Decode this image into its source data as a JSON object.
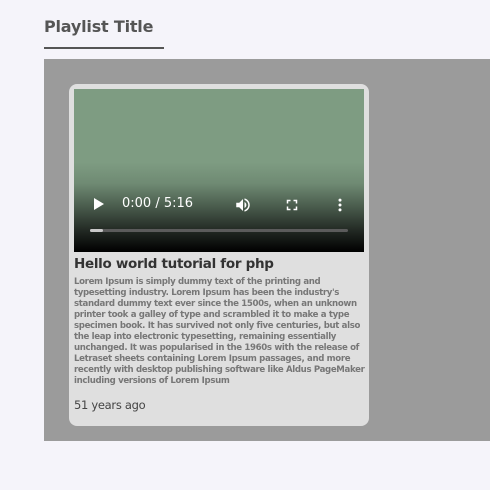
{
  "playlist": {
    "title": "Playlist Title"
  },
  "videos": [
    {
      "title": "Hello world tutorial for php",
      "description": "Lorem Ipsum is simply dummy text of the printing and typesetting industry. Lorem Ipsum has been the industry's standard dummy text ever since the 1500s, when an unknown printer took a galley of type and scrambled it to make a type specimen book. It has survived not only five centuries, but also the leap into electronic typesetting, remaining essentially unchanged. It was popularised in the 1960s with the release of Letraset sheets containing Lorem Ipsum passages, and more recently with desktop publishing software like Aldus PageMaker including versions of Lorem Ipsum",
      "age": "51 years ago",
      "player": {
        "time_display": "0:00 / 5:16",
        "played_fraction": 0.05,
        "icons": [
          "play-icon",
          "volume-icon",
          "fullscreen-icon",
          "more-options-icon"
        ]
      }
    }
  ],
  "colors": {
    "page_background": "#f5f4fa",
    "gallery_background": "#9b9b9b",
    "card_background": "#dfdfdf",
    "title_text": "#555555"
  }
}
